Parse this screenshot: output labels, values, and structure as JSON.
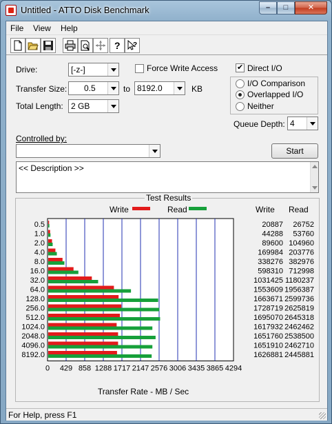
{
  "window": {
    "title": "Untitled - ATTO Disk Benchmark",
    "minimize": "–",
    "maximize": "□",
    "close": "✕"
  },
  "menu": [
    "File",
    "View",
    "Help"
  ],
  "toolbar": [
    "new-file-icon",
    "open-folder-icon",
    "save-icon",
    "print-icon",
    "print-preview-icon",
    "move-icon",
    "help-icon",
    "context-help-icon"
  ],
  "form": {
    "drive_label": "Drive:",
    "drive_value": "[-z-]",
    "force_write_label": "Force Write Access",
    "direct_io_label": "Direct I/O",
    "transfer_size_label": "Transfer Size:",
    "transfer_from": "0.5",
    "transfer_to_label": "to",
    "transfer_to": "8192.0",
    "transfer_unit": "KB",
    "total_length_label": "Total Length:",
    "total_length_value": "2 GB",
    "io_comparison_label": "I/O Comparison",
    "overlapped_io_label": "Overlapped I/O",
    "neither_label": "Neither",
    "queue_depth_label": "Queue Depth:",
    "queue_depth_value": "4",
    "controlled_by_label": "Controlled by:",
    "controlled_by_value": "",
    "start_label": "Start",
    "description_text": "<< Description >>"
  },
  "results": {
    "group_title": "Test Results",
    "legend_write": "Write",
    "legend_read": "Read",
    "col_write": "Write",
    "col_read": "Read"
  },
  "chart_data": {
    "type": "bar",
    "orientation": "horizontal",
    "categories": [
      "0.5",
      "1.0",
      "2.0",
      "4.0",
      "8.0",
      "16.0",
      "32.0",
      "64.0",
      "128.0",
      "256.0",
      "512.0",
      "1024.0",
      "2048.0",
      "4096.0",
      "8192.0"
    ],
    "series": [
      {
        "name": "Write",
        "color": "#e21b1b",
        "values": [
          20887,
          44288,
          89600,
          169984,
          338276,
          598310,
          1031425,
          1553609,
          1663671,
          1728719,
          1695070,
          1617932,
          1651760,
          1651910,
          1626881
        ]
      },
      {
        "name": "Read",
        "color": "#16a03a",
        "values": [
          26752,
          53760,
          104960,
          203776,
          382976,
          712998,
          1180237,
          1956387,
          2599736,
          2625819,
          2645318,
          2462462,
          2538500,
          2462710,
          2445881
        ]
      }
    ],
    "x_ticks": [
      "0",
      "429",
      "858",
      "1288",
      "1717",
      "2147",
      "2576",
      "3006",
      "3435",
      "3865",
      "4294"
    ],
    "xlim": [
      0,
      4294
    ],
    "xlabel": "Transfer Rate - MB / Sec",
    "grid": true,
    "legend": "top"
  },
  "status": {
    "text": "For Help, press F1"
  }
}
